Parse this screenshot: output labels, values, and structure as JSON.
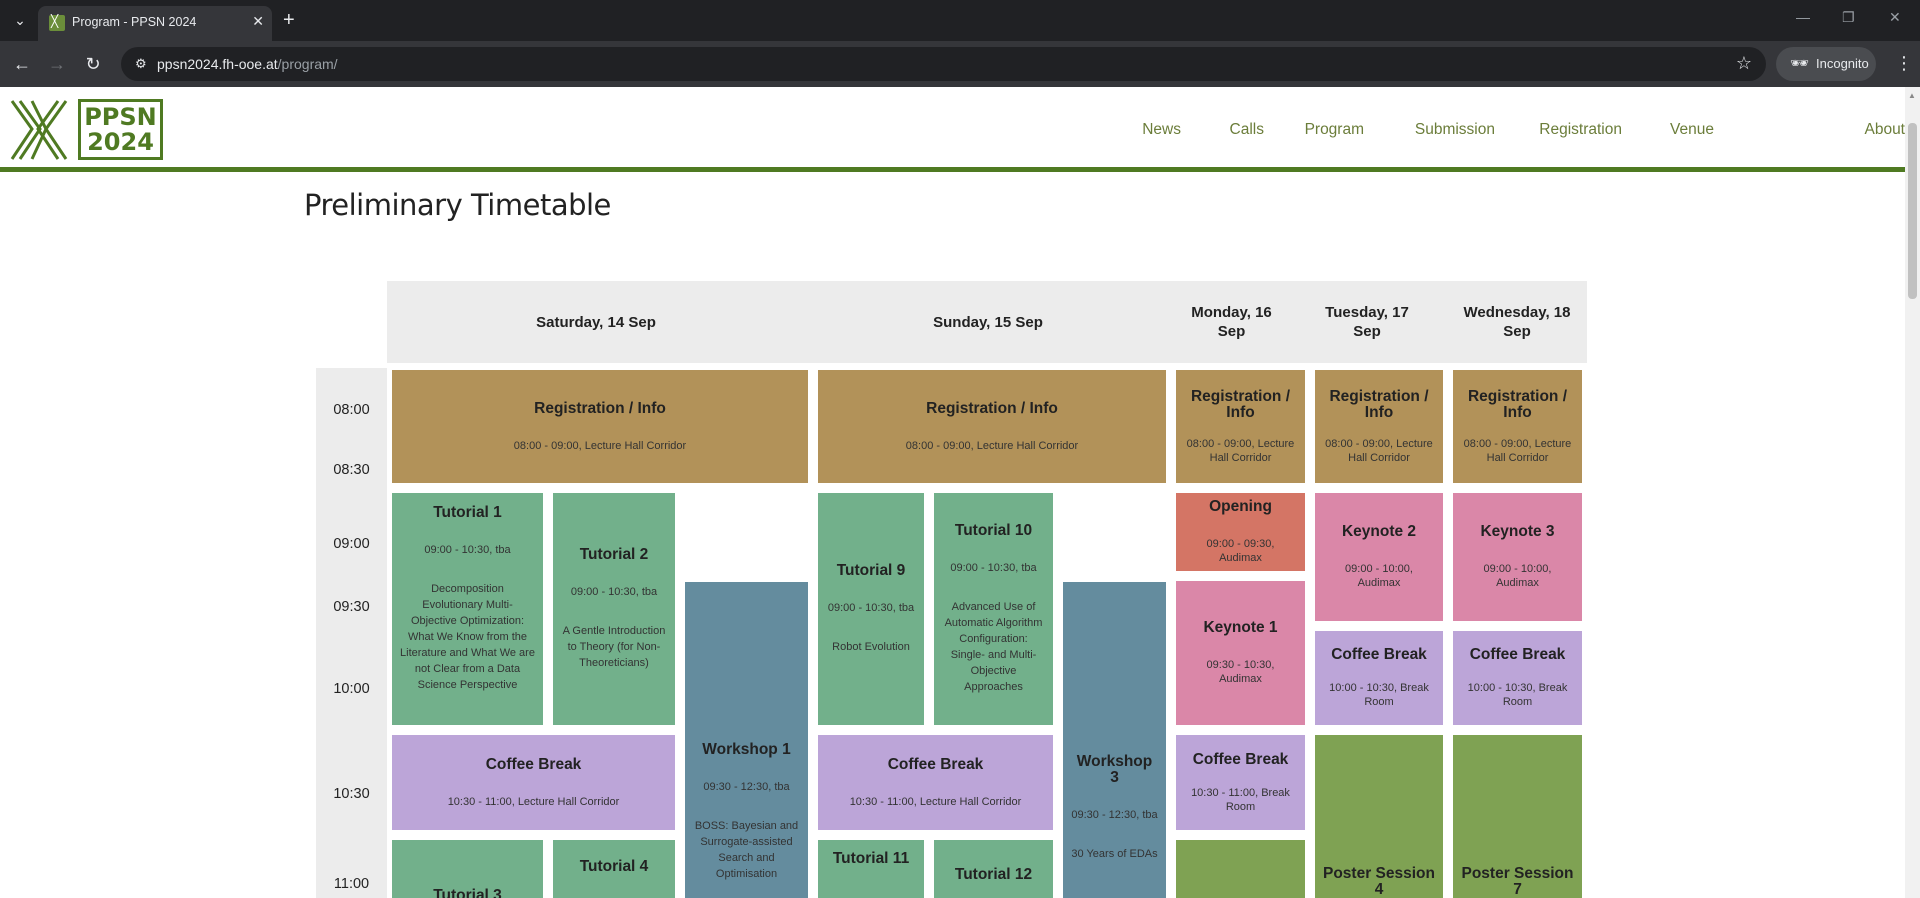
{
  "browser": {
    "tab_title": "Program - PPSN 2024",
    "url_host": "ppsn2024.fh-ooe.at",
    "url_path": "/program/",
    "profile": "Incognito"
  },
  "site": {
    "logo_line1": "PPSN",
    "logo_line2": "2024",
    "nav": [
      "News",
      "Calls",
      "Program",
      "Submission",
      "Registration",
      "Venue",
      "About"
    ]
  },
  "page": {
    "title": "Preliminary Timetable"
  },
  "timetable": {
    "days": [
      "Saturday, 14 Sep",
      "Sunday, 15 Sep",
      "Monday, 16 Sep",
      "Tuesday, 17 Sep",
      "Wednesday, 18 Sep"
    ],
    "times": [
      "08:00",
      "08:30",
      "09:00",
      "09:30",
      "10:00",
      "10:30",
      "11:00"
    ],
    "events": {
      "sat_reg": {
        "title": "Registration / Info",
        "sub": "08:00 - 09:00, Lecture Hall Corridor"
      },
      "sun_reg": {
        "title": "Registration / Info",
        "sub": "08:00 - 09:00, Lecture Hall Corridor"
      },
      "mon_reg": {
        "title": "Registration / Info",
        "sub": "08:00 - 09:00, Lecture Hall Corridor"
      },
      "tue_reg": {
        "title": "Registration / Info",
        "sub": "08:00 - 09:00, Lecture Hall Corridor"
      },
      "wed_reg": {
        "title": "Registration / Info",
        "sub": "08:00 - 09:00, Lecture Hall Corridor"
      },
      "tut1": {
        "title": "Tutorial 1",
        "sub": "09:00 - 10:30, tba",
        "desc": "Decomposition Evolutionary Multi-Objective Optimization: What We Know from the Literature and What We are not Clear from a Data Science Perspective"
      },
      "tut2": {
        "title": "Tutorial 2",
        "sub": "09:00 - 10:30, tba",
        "desc": "A Gentle Introduction to Theory (for Non-Theoreticians)"
      },
      "ws1": {
        "title": "Workshop 1",
        "sub": "09:30 - 12:30, tba",
        "desc": "BOSS: Bayesian and Surrogate-assisted Search and Optimisation"
      },
      "tut9": {
        "title": "Tutorial 9",
        "sub": "09:00 - 10:30, tba",
        "desc": "Robot Evolution"
      },
      "tut10": {
        "title": "Tutorial 10",
        "sub": "09:00 - 10:30, tba",
        "desc": "Advanced Use of Automatic Algorithm Configuration: Single- and Multi-Objective Approaches"
      },
      "ws3": {
        "title": "Workshop 3",
        "sub": "09:30 - 12:30, tba",
        "desc": "30 Years of EDAs"
      },
      "opening": {
        "title": "Opening",
        "sub": "09:00 - 09:30, Audimax"
      },
      "key1": {
        "title": "Keynote 1",
        "sub": "09:30 - 10:30, Audimax"
      },
      "key2": {
        "title": "Keynote 2",
        "sub": "09:00 - 10:00, Audimax"
      },
      "key3": {
        "title": "Keynote 3",
        "sub": "09:00 - 10:00, Audimax"
      },
      "sat_coffee": {
        "title": "Coffee Break",
        "sub": "10:30 - 11:00, Lecture Hall Corridor"
      },
      "sun_coffee": {
        "title": "Coffee Break",
        "sub": "10:30 - 11:00, Lecture Hall Corridor"
      },
      "mon_coffee": {
        "title": "Coffee Break",
        "sub": "10:30 - 11:00, Break Room"
      },
      "tue_coffee": {
        "title": "Coffee Break",
        "sub": "10:00 - 10:30, Break Room"
      },
      "wed_coffee": {
        "title": "Coffee Break",
        "sub": "10:00 - 10:30, Break Room"
      },
      "tut3": {
        "title": "Tutorial 3"
      },
      "tut4": {
        "title": "Tutorial 4"
      },
      "tut11": {
        "title": "Tutorial 11"
      },
      "tut12": {
        "title": "Tutorial 12"
      },
      "poster4": {
        "title": "Poster Session 4"
      },
      "poster7": {
        "title": "Poster Session 7"
      }
    }
  }
}
